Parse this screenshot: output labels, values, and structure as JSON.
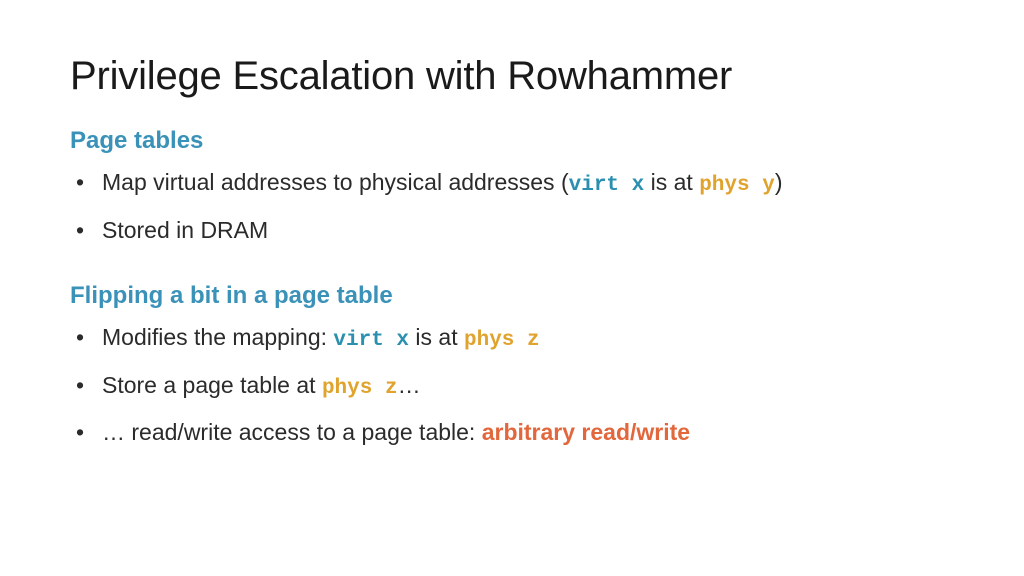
{
  "title": "Privilege Escalation with Rowhammer",
  "section1": {
    "heading": "Page tables",
    "bullet1_a": "Map virtual addresses to physical addresses (",
    "bullet1_code1": "virt x",
    "bullet1_mid": " is at ",
    "bullet1_code2": "phys y",
    "bullet1_b": ")",
    "bullet2": "Stored in DRAM"
  },
  "section2": {
    "heading": "Flipping a bit in a page table",
    "bullet1_a": "Modifies the mapping: ",
    "bullet1_code1": "virt x",
    "bullet1_mid": " is at ",
    "bullet1_code2": "phys z",
    "bullet2_a": "Store a page table at ",
    "bullet2_code": "phys z",
    "bullet2_b": "…",
    "bullet3_a": "… read/write access to a page table: ",
    "bullet3_em": "arbitrary read/write"
  }
}
